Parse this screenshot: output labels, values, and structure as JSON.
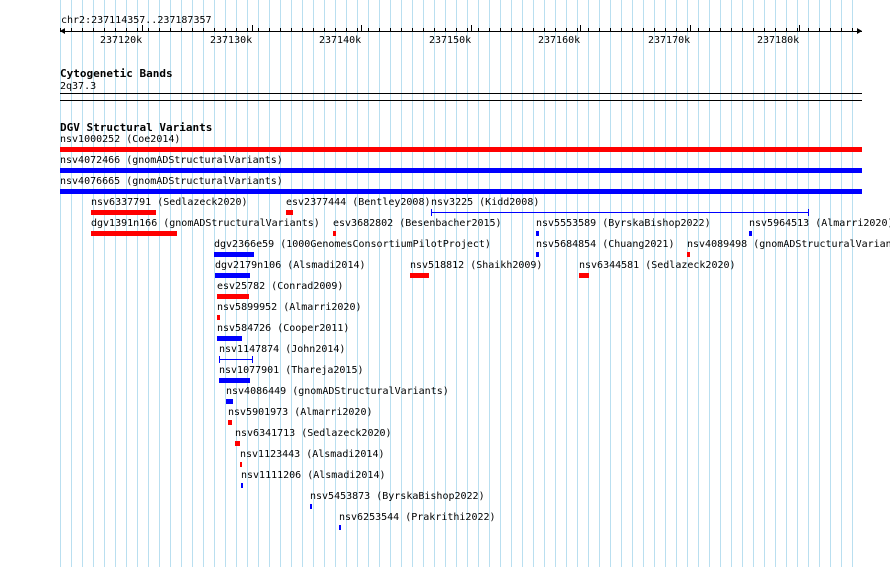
{
  "colors": {
    "gridline": "#b9dff0",
    "loss": "#ff0000",
    "gain": "#0000ff",
    "text": "#000000"
  },
  "ruler": {
    "region": "chr2:237114357..237187357",
    "ticks": [
      "237120k",
      "237130k",
      "237140k",
      "237150k",
      "237160k",
      "237170k",
      "237180k"
    ]
  },
  "tracks": {
    "cyto": {
      "title": "Cytogenetic Bands",
      "band": "2q37.3"
    },
    "dgv": {
      "title": "DGV Structural Variants"
    }
  },
  "variants": [
    {
      "id": "nsv1000252",
      "study": "(Coe2014)",
      "color": "loss",
      "style": "bar"
    },
    {
      "id": "nsv4072466",
      "study": "(gnomADStructuralVariants)",
      "color": "gain",
      "style": "bar"
    },
    {
      "id": "nsv4076665",
      "study": "(gnomADStructuralVariants)",
      "color": "gain",
      "style": "bar"
    },
    {
      "id": "nsv6337791",
      "study": "(Sedlazeck2020)",
      "color": "loss",
      "style": "bar"
    },
    {
      "id": "esv2377444",
      "study": "(Bentley2008)",
      "color": "loss",
      "style": "bar"
    },
    {
      "id": "nsv3225",
      "study": "(Kidd2008)",
      "color": "gain",
      "style": "line"
    },
    {
      "id": "dgv1391n166",
      "study": "(gnomADStructuralVariants)",
      "color": "loss",
      "style": "bar"
    },
    {
      "id": "esv3682802",
      "study": "(Besenbacher2015)",
      "color": "loss",
      "style": "bar"
    },
    {
      "id": "nsv5553589",
      "study": "(ByrskaBishop2022)",
      "color": "gain",
      "style": "bar"
    },
    {
      "id": "nsv5964513",
      "study": "(Almarri2020)",
      "color": "gain",
      "style": "bar"
    },
    {
      "id": "dgv2366e59",
      "study": "(1000GenomesConsortiumPilotProject)",
      "color": "gain",
      "style": "bar"
    },
    {
      "id": "nsv5684854",
      "study": "(Chuang2021)",
      "color": "gain",
      "style": "bar"
    },
    {
      "id": "nsv4089498",
      "study": "(gnomADStructuralVariants)",
      "color": "loss",
      "style": "bar"
    },
    {
      "id": "dgv2179n106",
      "study": "(Alsmadi2014)",
      "color": "gain",
      "style": "bar"
    },
    {
      "id": "nsv518812",
      "study": "(Shaikh2009)",
      "color": "loss",
      "style": "bar"
    },
    {
      "id": "nsv6344581",
      "study": "(Sedlazeck2020)",
      "color": "loss",
      "style": "bar"
    },
    {
      "id": "esv25782",
      "study": "(Conrad2009)",
      "color": "loss",
      "style": "bar"
    },
    {
      "id": "nsv5899952",
      "study": "(Almarri2020)",
      "color": "loss",
      "style": "bar"
    },
    {
      "id": "nsv584726",
      "study": "(Cooper2011)",
      "color": "gain",
      "style": "bar"
    },
    {
      "id": "nsv1147874",
      "study": "(John2014)",
      "color": "gain",
      "style": "line"
    },
    {
      "id": "nsv1077901",
      "study": "(Thareja2015)",
      "color": "gain",
      "style": "bar"
    },
    {
      "id": "nsv4086449",
      "study": "(gnomADStructuralVariants)",
      "color": "gain",
      "style": "bar"
    },
    {
      "id": "nsv5901973",
      "study": "(Almarri2020)",
      "color": "loss",
      "style": "bar"
    },
    {
      "id": "nsv6341713",
      "study": "(Sedlazeck2020)",
      "color": "loss",
      "style": "bar"
    },
    {
      "id": "nsv1123443",
      "study": "(Alsmadi2014)",
      "color": "loss",
      "style": "bar"
    },
    {
      "id": "nsv1111206",
      "study": "(Alsmadi2014)",
      "color": "gain",
      "style": "bar"
    },
    {
      "id": "nsv5453873",
      "study": "(ByrskaBishop2022)",
      "color": "gain",
      "style": "bar"
    },
    {
      "id": "nsv6253544",
      "study": "(Prakrithi2022)",
      "color": "gain",
      "style": "bar"
    }
  ]
}
